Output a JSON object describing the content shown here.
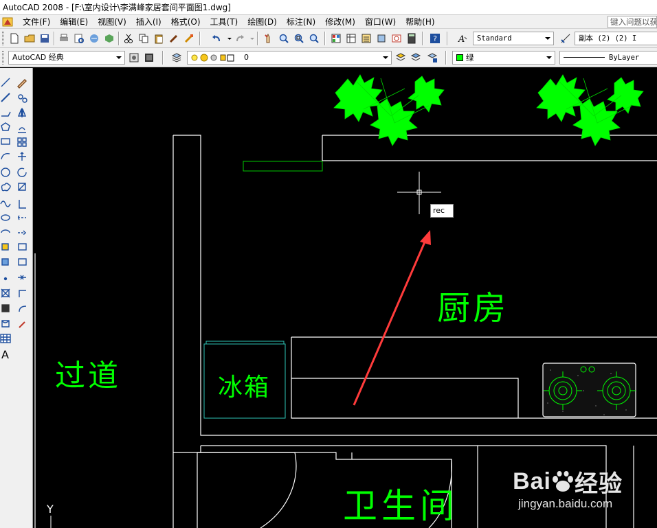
{
  "window": {
    "title": "AutoCAD 2008 - [F:\\室内设计\\李满峰家居套间平面图1.dwg]"
  },
  "menu": {
    "items": [
      "文件(F)",
      "编辑(E)",
      "视图(V)",
      "插入(I)",
      "格式(O)",
      "工具(T)",
      "绘图(D)",
      "标注(N)",
      "修改(M)",
      "窗口(W)",
      "帮助(H)"
    ],
    "help_search_placeholder": "键入问题以获"
  },
  "toolbar_standard": {
    "text_style": "Standard",
    "dim_style": "副本 (2) (2) I"
  },
  "toolbar_layers": {
    "workspace": "AutoCAD 经典",
    "current_layer": "0",
    "color": "绿",
    "color_hex": "#00ff00",
    "linetype": "ByLayer"
  },
  "canvas": {
    "command_input": "rec",
    "room_labels": {
      "kitchen": "厨房",
      "fridge": "冰箱",
      "corridor": "过道",
      "bathroom": "卫生间"
    },
    "ucs_axis_label": "Y"
  },
  "colors": {
    "drawing_green": "#00ff00",
    "annotation_arrow": "#ff3b3b",
    "background": "#000000",
    "fridge_outline": "#2ec4b6"
  },
  "watermark": {
    "brand_left": "Bai",
    "brand_right": "经验",
    "url": "jingyan.baidu.com"
  }
}
